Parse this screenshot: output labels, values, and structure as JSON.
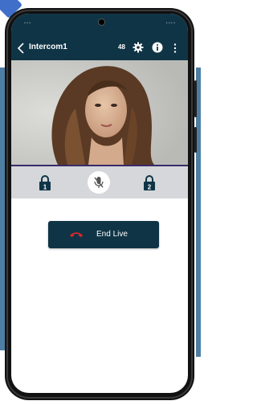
{
  "appbar": {
    "title": "Intercom1",
    "count": "48",
    "back_icon": "chevron-left-icon",
    "settings_icon": "gear-icon",
    "info_icon": "info-icon",
    "more_icon": "more-vert-icon"
  },
  "controls": {
    "lock1_icon": "lock-1-icon",
    "lock1_number": "1",
    "mic_icon": "mic-off-icon",
    "lock2_icon": "lock-2-icon",
    "lock2_number": "2"
  },
  "end_live": {
    "label": "End Live",
    "icon": "phone-hangup-icon"
  },
  "colors": {
    "brand_dark": "#0f3446",
    "hangup_red": "#d9262a",
    "control_bar": "#d5d7da"
  }
}
